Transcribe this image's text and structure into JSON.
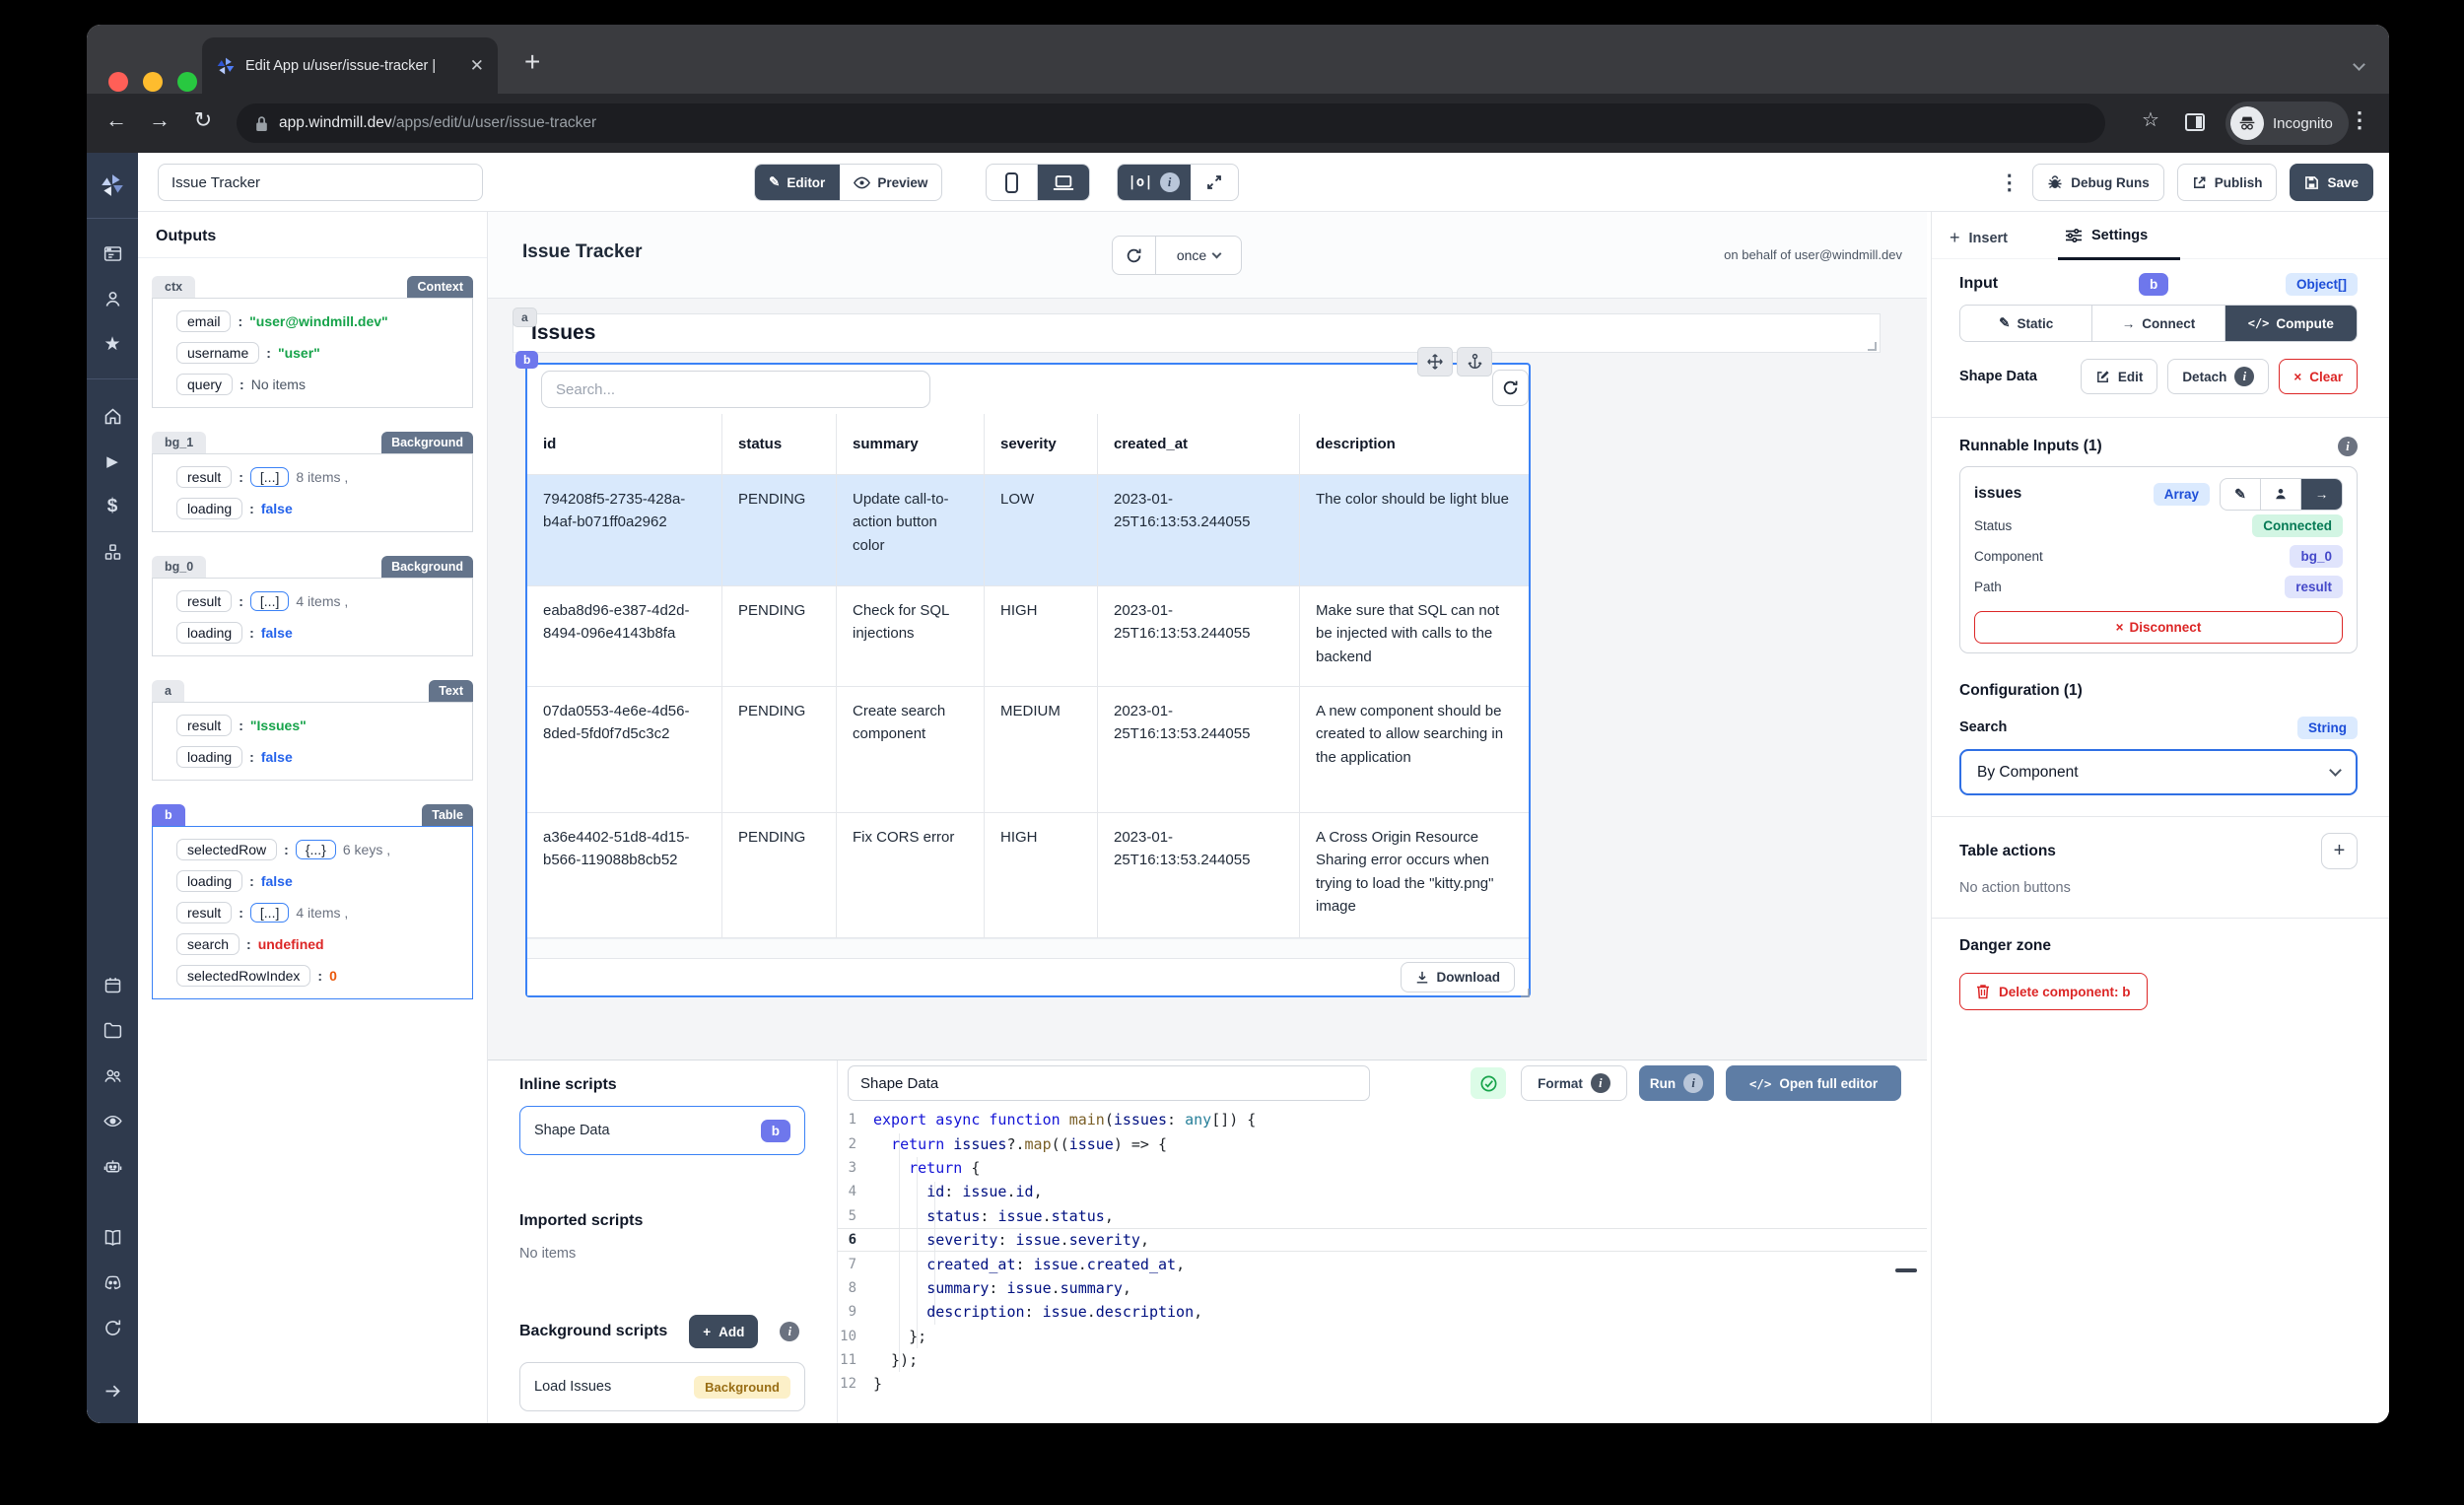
{
  "colors": {
    "accent": "#3b82f6",
    "dark_button": "#3d4a5c",
    "indigo_chip": "#6e77ec",
    "steel_button": "#5e7da5",
    "danger": "#dc2626",
    "selected_row": "#d9e9fc",
    "badge_yellow": "#fcf0c8",
    "badge_green": "#d2f5e3"
  },
  "browser": {
    "tab_title": "Edit App u/user/issue-tracker |",
    "url_domain": "app.windmill.dev",
    "url_path": "/apps/edit/u/user/issue-tracker",
    "incognito_label": "Incognito"
  },
  "topbar": {
    "app_name_value": "Issue Tracker",
    "editor": "Editor",
    "preview": "Preview",
    "outputs_toggle": "|o|",
    "debug_runs": "Debug Runs",
    "publish": "Publish",
    "save": "Save"
  },
  "sidebar": {
    "logo": "windmill-logo",
    "group1": [
      "app-window",
      "user",
      "star"
    ],
    "group2": [
      "home",
      "play",
      "dollar",
      "cubes"
    ],
    "group3": [
      "calendar",
      "folder",
      "users",
      "eye",
      "robot"
    ],
    "group4": [
      "book",
      "discord",
      "sync"
    ],
    "bottom": [
      "arrow-right"
    ]
  },
  "outputs": {
    "title": "Outputs",
    "sections": [
      {
        "id": "ctx",
        "badge": "Context",
        "selected": false,
        "rows": [
          {
            "key": "email",
            "val": "\"user@windmill.dev\"",
            "cls": "str"
          },
          {
            "key": "username",
            "val": "\"user\"",
            "cls": "str"
          },
          {
            "key": "query",
            "val": "No items",
            "cls": "plain"
          }
        ]
      },
      {
        "id": "bg_1",
        "badge": "Background",
        "selected": false,
        "rows": [
          {
            "key": "result",
            "pill": "[...]",
            "suffix": "8 items ,"
          },
          {
            "key": "loading",
            "val": "false",
            "cls": "bool"
          }
        ]
      },
      {
        "id": "bg_0",
        "badge": "Background",
        "selected": false,
        "rows": [
          {
            "key": "result",
            "pill": "[...]",
            "suffix": "4 items ,"
          },
          {
            "key": "loading",
            "val": "false",
            "cls": "bool"
          }
        ]
      },
      {
        "id": "a",
        "badge": "Text",
        "selected": false,
        "rows": [
          {
            "key": "result",
            "val": "\"Issues\"",
            "cls": "str"
          },
          {
            "key": "loading",
            "val": "false",
            "cls": "bool"
          }
        ]
      },
      {
        "id": "b",
        "badge": "Table",
        "selected": true,
        "rows": [
          {
            "key": "selectedRow",
            "pill": "{...}",
            "suffix": "6 keys ,"
          },
          {
            "key": "loading",
            "val": "false",
            "cls": "bool"
          },
          {
            "key": "result",
            "pill": "[...]",
            "suffix": "4 items ,"
          },
          {
            "key": "search",
            "val": "undefined",
            "cls": "undef"
          },
          {
            "key": "selectedRowIndex",
            "val": "0",
            "cls": "num"
          }
        ]
      }
    ]
  },
  "canvas": {
    "header": {
      "title": "Issue Tracker",
      "refresh_mode": "once",
      "on_behalf": "on behalf of user@windmill.dev"
    },
    "text_component": {
      "chip": "a",
      "text": "Issues"
    },
    "table": {
      "chip": "b",
      "search_placeholder": "Search...",
      "download": "Download",
      "columns": [
        "id",
        "status",
        "summary",
        "severity",
        "created_at",
        "description"
      ],
      "rows": [
        {
          "selected": true,
          "cells": [
            "794208f5-2735-428a-b4af-b071ff0a2962",
            "PENDING",
            "Update call-to-action button color",
            "LOW",
            "2023-01-25T16:13:53.244055",
            "The color should be light blue"
          ]
        },
        {
          "selected": false,
          "cells": [
            "eaba8d96-e387-4d2d-8494-096e4143b8fa",
            "PENDING",
            "Check for SQL injections",
            "HIGH",
            "2023-01-25T16:13:53.244055",
            "Make sure that SQL can not be injected with calls to the backend"
          ]
        },
        {
          "selected": false,
          "cells": [
            "07da0553-4e6e-4d56-8ded-5fd0f7d5c3c2",
            "PENDING",
            "Create search component",
            "MEDIUM",
            "2023-01-25T16:13:53.244055",
            "A new component should be created to allow searching in the application"
          ]
        },
        {
          "selected": false,
          "cells": [
            "a36e4402-51d8-4d15-b566-119088b8cb52",
            "PENDING",
            "Fix CORS error",
            "HIGH",
            "2023-01-25T16:13:53.244055",
            "A Cross Origin Resource Sharing error occurs when trying to load the \"kitty.png\" image"
          ]
        }
      ]
    }
  },
  "scripts_panel": {
    "inline_title": "Inline scripts",
    "inline_items": [
      {
        "name": "Shape Data",
        "badge": "b",
        "selected": true
      }
    ],
    "imported_title": "Imported scripts",
    "imported_empty": "No items",
    "background_title": "Background scripts",
    "add": "Add",
    "background_items": [
      {
        "name": "Load Issues",
        "badge": "Background"
      }
    ]
  },
  "editor": {
    "name": "Shape Data",
    "format": "Format",
    "run": "Run",
    "open_full": "Open full editor",
    "active_line": 6,
    "lines": [
      [
        [
          "k",
          "export"
        ],
        [
          "p",
          " "
        ],
        [
          "k",
          "async"
        ],
        [
          "p",
          " "
        ],
        [
          "k",
          "function"
        ],
        [
          "p",
          " "
        ],
        [
          "f",
          "main"
        ],
        [
          "p",
          "("
        ],
        [
          "v",
          "issues"
        ],
        [
          "p",
          ": "
        ],
        [
          "t",
          "any"
        ],
        [
          "p",
          "[]) {"
        ]
      ],
      [
        [
          "p",
          "  "
        ],
        [
          "k",
          "return"
        ],
        [
          "p",
          " "
        ],
        [
          "v",
          "issues"
        ],
        [
          "p",
          "?."
        ],
        [
          "f",
          "map"
        ],
        [
          "p",
          "(("
        ],
        [
          "v",
          "issue"
        ],
        [
          "p",
          ") => {"
        ]
      ],
      [
        [
          "p",
          "    "
        ],
        [
          "k",
          "return"
        ],
        [
          "p",
          " {"
        ]
      ],
      [
        [
          "p",
          "      "
        ],
        [
          "v",
          "id"
        ],
        [
          "p",
          ": "
        ],
        [
          "v",
          "issue"
        ],
        [
          "p",
          "."
        ],
        [
          "v",
          "id"
        ],
        [
          "p",
          ","
        ]
      ],
      [
        [
          "p",
          "      "
        ],
        [
          "v",
          "status"
        ],
        [
          "p",
          ": "
        ],
        [
          "v",
          "issue"
        ],
        [
          "p",
          "."
        ],
        [
          "v",
          "status"
        ],
        [
          "p",
          ","
        ]
      ],
      [
        [
          "p",
          "      "
        ],
        [
          "v",
          "severity"
        ],
        [
          "p",
          ": "
        ],
        [
          "v",
          "issue"
        ],
        [
          "p",
          "."
        ],
        [
          "v",
          "severity"
        ],
        [
          "p",
          ","
        ]
      ],
      [
        [
          "p",
          "      "
        ],
        [
          "v",
          "created_at"
        ],
        [
          "p",
          ": "
        ],
        [
          "v",
          "issue"
        ],
        [
          "p",
          "."
        ],
        [
          "v",
          "created_at"
        ],
        [
          "p",
          ","
        ]
      ],
      [
        [
          "p",
          "      "
        ],
        [
          "v",
          "summary"
        ],
        [
          "p",
          ": "
        ],
        [
          "v",
          "issue"
        ],
        [
          "p",
          "."
        ],
        [
          "v",
          "summary"
        ],
        [
          "p",
          ","
        ]
      ],
      [
        [
          "p",
          "      "
        ],
        [
          "v",
          "description"
        ],
        [
          "p",
          ": "
        ],
        [
          "v",
          "issue"
        ],
        [
          "p",
          "."
        ],
        [
          "v",
          "description"
        ],
        [
          "p",
          ","
        ]
      ],
      [
        [
          "p",
          "    };"
        ]
      ],
      [
        [
          "p",
          "  });"
        ]
      ],
      [
        [
          "p",
          "}"
        ]
      ]
    ]
  },
  "settings": {
    "tab_insert": "Insert",
    "tab_settings": "Settings",
    "input_label": "Input",
    "component_id": "b",
    "input_type": "Object[]",
    "modes": [
      "Static",
      "Connect",
      "Compute"
    ],
    "active_mode": "Compute",
    "script_name": "Shape Data",
    "edit": "Edit",
    "detach": "Detach",
    "clear": "Clear",
    "runnable_title": "Runnable Inputs (1)",
    "runnable_field": "issues",
    "field_type": "Array",
    "status_label": "Status",
    "status_value": "Connected",
    "component_label": "Component",
    "component_value": "bg_0",
    "path_label": "Path",
    "path_value": "result",
    "disconnect": "Disconnect",
    "config_title": "Configuration (1)",
    "search_label": "Search",
    "search_type": "String",
    "search_value": "By Component",
    "table_actions_title": "Table actions",
    "no_actions": "No action buttons",
    "danger_title": "Danger zone",
    "delete_label": "Delete component: b"
  }
}
